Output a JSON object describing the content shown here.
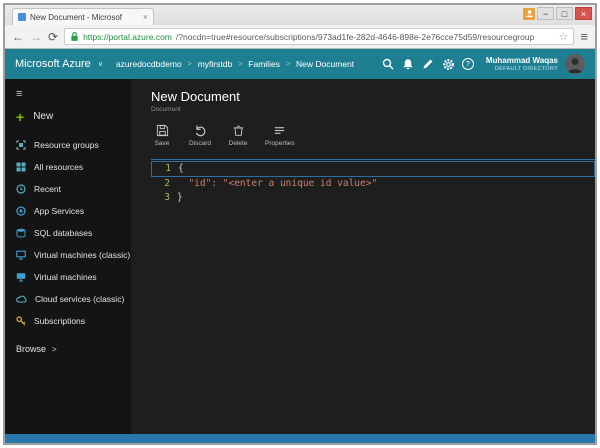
{
  "icons": {
    "minimize": "−",
    "maximize": "□",
    "close": "×",
    "back": "←",
    "forward": "→",
    "refresh": "⟳",
    "star": "☆",
    "menu": "≡",
    "hamburger": "≡",
    "brand_chevron": "∨",
    "crumb_sep": ">",
    "browse_chevron": ">",
    "plus": "+",
    "help": "?"
  },
  "browser": {
    "tab_title": "New Document - Microsof",
    "url_secure": "https://portal.azure.com",
    "url_rest": "/?nocdn=true#resource/subscriptions/973ad1fe-282d-4646-898e-2e76cce75d59/resourcegroup"
  },
  "header": {
    "brand": "Microsoft Azure",
    "breadcrumbs": [
      "azuredocdbdemo",
      "myfirstdb",
      "Families",
      "New Document"
    ],
    "user": {
      "name": "Muhammad Waqas",
      "directory": "DEFAULT DIRECTORY"
    }
  },
  "sidebar": {
    "new_label": "New",
    "items": [
      {
        "label": "Resource groups"
      },
      {
        "label": "All resources"
      },
      {
        "label": "Recent"
      },
      {
        "label": "App Services"
      },
      {
        "label": "SQL databases"
      },
      {
        "label": "Virtual machines (classic)"
      },
      {
        "label": "Virtual machines"
      },
      {
        "label": "Cloud services (classic)"
      },
      {
        "label": "Subscriptions"
      }
    ],
    "browse_label": "Browse"
  },
  "main": {
    "title": "New Document",
    "subtitle": "Document",
    "toolbar": {
      "save": "Save",
      "discard": "Discard",
      "delete": "Delete",
      "properties": "Properties"
    },
    "editor": {
      "lines": [
        {
          "num": "1",
          "code": "{"
        },
        {
          "num": "2",
          "code": "  \"id\": \"<enter a unique id value>\""
        },
        {
          "num": "3",
          "code": "}"
        }
      ]
    }
  }
}
